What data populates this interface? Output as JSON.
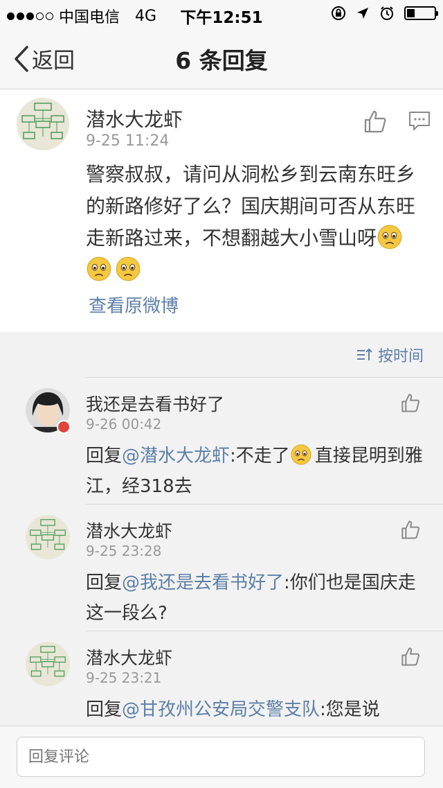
{
  "status_bar": {
    "carrier": "中国电信",
    "network": "4G",
    "time": "下午12:51",
    "signal_bars": 3,
    "signal_total": 5,
    "battery_level": 0.3
  },
  "nav": {
    "back_label": "返回",
    "title": "6 条回复"
  },
  "post": {
    "author": "潜水大龙虾",
    "date": "9-25 11:24",
    "text": "警察叔叔，请问从洞松乡到云南东旺乡的新路修好了么？国庆期间可否从东旺走新路过来，不想翻越大小雪山呀",
    "emojis": [
      "sad-face-emoji",
      "sad-face-emoji",
      "sad-face-emoji"
    ],
    "view_original_label": "查看原微博"
  },
  "sort": {
    "label": "按时间"
  },
  "replies": [
    {
      "author": "我还是去看书好了",
      "date": "9-26 00:42",
      "prefix": "回复",
      "mention": "@潜水大龙虾",
      "text_before_emoji": ":不走了",
      "text_after_emoji": "直接昆明到雅江，经318去",
      "verified": true
    },
    {
      "author": "潜水大龙虾",
      "date": "9-25 23:28",
      "prefix": "回复",
      "mention": "@我还是去看书好了",
      "text": ":你们也是国庆走这一段么?"
    },
    {
      "author": "潜水大龙虾",
      "date": "9-25 23:21",
      "prefix": "回复",
      "mention": "@甘孜州公安局交警支队",
      "text": ":您是说"
    }
  ],
  "input": {
    "placeholder": "回复评论"
  },
  "colors": {
    "link": "#5c7fa8",
    "background": "#f2f2f2",
    "card": "#ffffff"
  }
}
